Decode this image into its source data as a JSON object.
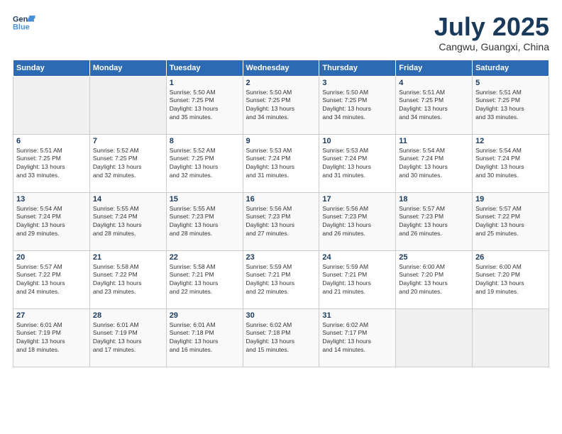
{
  "header": {
    "logo_line1": "General",
    "logo_line2": "Blue",
    "month_title": "July 2025",
    "location": "Cangwu, Guangxi, China"
  },
  "weekdays": [
    "Sunday",
    "Monday",
    "Tuesday",
    "Wednesday",
    "Thursday",
    "Friday",
    "Saturday"
  ],
  "weeks": [
    [
      {
        "day": "",
        "detail": ""
      },
      {
        "day": "",
        "detail": ""
      },
      {
        "day": "1",
        "detail": "Sunrise: 5:50 AM\nSunset: 7:25 PM\nDaylight: 13 hours\nand 35 minutes."
      },
      {
        "day": "2",
        "detail": "Sunrise: 5:50 AM\nSunset: 7:25 PM\nDaylight: 13 hours\nand 34 minutes."
      },
      {
        "day": "3",
        "detail": "Sunrise: 5:50 AM\nSunset: 7:25 PM\nDaylight: 13 hours\nand 34 minutes."
      },
      {
        "day": "4",
        "detail": "Sunrise: 5:51 AM\nSunset: 7:25 PM\nDaylight: 13 hours\nand 34 minutes."
      },
      {
        "day": "5",
        "detail": "Sunrise: 5:51 AM\nSunset: 7:25 PM\nDaylight: 13 hours\nand 33 minutes."
      }
    ],
    [
      {
        "day": "6",
        "detail": "Sunrise: 5:51 AM\nSunset: 7:25 PM\nDaylight: 13 hours\nand 33 minutes."
      },
      {
        "day": "7",
        "detail": "Sunrise: 5:52 AM\nSunset: 7:25 PM\nDaylight: 13 hours\nand 32 minutes."
      },
      {
        "day": "8",
        "detail": "Sunrise: 5:52 AM\nSunset: 7:25 PM\nDaylight: 13 hours\nand 32 minutes."
      },
      {
        "day": "9",
        "detail": "Sunrise: 5:53 AM\nSunset: 7:24 PM\nDaylight: 13 hours\nand 31 minutes."
      },
      {
        "day": "10",
        "detail": "Sunrise: 5:53 AM\nSunset: 7:24 PM\nDaylight: 13 hours\nand 31 minutes."
      },
      {
        "day": "11",
        "detail": "Sunrise: 5:54 AM\nSunset: 7:24 PM\nDaylight: 13 hours\nand 30 minutes."
      },
      {
        "day": "12",
        "detail": "Sunrise: 5:54 AM\nSunset: 7:24 PM\nDaylight: 13 hours\nand 30 minutes."
      }
    ],
    [
      {
        "day": "13",
        "detail": "Sunrise: 5:54 AM\nSunset: 7:24 PM\nDaylight: 13 hours\nand 29 minutes."
      },
      {
        "day": "14",
        "detail": "Sunrise: 5:55 AM\nSunset: 7:24 PM\nDaylight: 13 hours\nand 28 minutes."
      },
      {
        "day": "15",
        "detail": "Sunrise: 5:55 AM\nSunset: 7:23 PM\nDaylight: 13 hours\nand 28 minutes."
      },
      {
        "day": "16",
        "detail": "Sunrise: 5:56 AM\nSunset: 7:23 PM\nDaylight: 13 hours\nand 27 minutes."
      },
      {
        "day": "17",
        "detail": "Sunrise: 5:56 AM\nSunset: 7:23 PM\nDaylight: 13 hours\nand 26 minutes."
      },
      {
        "day": "18",
        "detail": "Sunrise: 5:57 AM\nSunset: 7:23 PM\nDaylight: 13 hours\nand 26 minutes."
      },
      {
        "day": "19",
        "detail": "Sunrise: 5:57 AM\nSunset: 7:22 PM\nDaylight: 13 hours\nand 25 minutes."
      }
    ],
    [
      {
        "day": "20",
        "detail": "Sunrise: 5:57 AM\nSunset: 7:22 PM\nDaylight: 13 hours\nand 24 minutes."
      },
      {
        "day": "21",
        "detail": "Sunrise: 5:58 AM\nSunset: 7:22 PM\nDaylight: 13 hours\nand 23 minutes."
      },
      {
        "day": "22",
        "detail": "Sunrise: 5:58 AM\nSunset: 7:21 PM\nDaylight: 13 hours\nand 22 minutes."
      },
      {
        "day": "23",
        "detail": "Sunrise: 5:59 AM\nSunset: 7:21 PM\nDaylight: 13 hours\nand 22 minutes."
      },
      {
        "day": "24",
        "detail": "Sunrise: 5:59 AM\nSunset: 7:21 PM\nDaylight: 13 hours\nand 21 minutes."
      },
      {
        "day": "25",
        "detail": "Sunrise: 6:00 AM\nSunset: 7:20 PM\nDaylight: 13 hours\nand 20 minutes."
      },
      {
        "day": "26",
        "detail": "Sunrise: 6:00 AM\nSunset: 7:20 PM\nDaylight: 13 hours\nand 19 minutes."
      }
    ],
    [
      {
        "day": "27",
        "detail": "Sunrise: 6:01 AM\nSunset: 7:19 PM\nDaylight: 13 hours\nand 18 minutes."
      },
      {
        "day": "28",
        "detail": "Sunrise: 6:01 AM\nSunset: 7:19 PM\nDaylight: 13 hours\nand 17 minutes."
      },
      {
        "day": "29",
        "detail": "Sunrise: 6:01 AM\nSunset: 7:18 PM\nDaylight: 13 hours\nand 16 minutes."
      },
      {
        "day": "30",
        "detail": "Sunrise: 6:02 AM\nSunset: 7:18 PM\nDaylight: 13 hours\nand 15 minutes."
      },
      {
        "day": "31",
        "detail": "Sunrise: 6:02 AM\nSunset: 7:17 PM\nDaylight: 13 hours\nand 14 minutes."
      },
      {
        "day": "",
        "detail": ""
      },
      {
        "day": "",
        "detail": ""
      }
    ]
  ]
}
